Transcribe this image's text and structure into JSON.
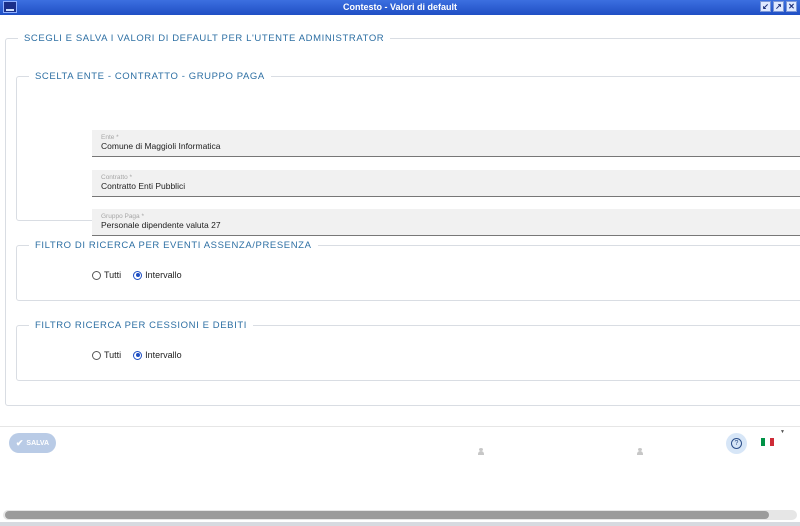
{
  "window": {
    "title": "Contesto - Valori di default",
    "controls": [
      "minimize-icon",
      "maximize-icon",
      "close-icon"
    ]
  },
  "outer_section": {
    "legend": "SCEGLI E SALVA I VALORI DI DEFAULT PER L'UTENTE ADMINISTRATOR"
  },
  "group_ente": {
    "legend": "SCELTA ENTE - CONTRATTO - GRUPPO PAGA",
    "fields": [
      {
        "label": "Ente *",
        "value": "Comune di Maggioli Informatica"
      },
      {
        "label": "Contratto *",
        "value": "Contratto Enti Pubblici"
      },
      {
        "label": "Gruppo Paga *",
        "value": "Personale dipendente valuta 27"
      }
    ]
  },
  "group_eventi": {
    "legend": "FILTRO DI RICERCA PER EVENTI ASSENZA/PRESENZA",
    "options": [
      {
        "label": "Tutti",
        "checked": false
      },
      {
        "label": "Intervallo",
        "checked": true
      }
    ]
  },
  "group_cessioni": {
    "legend": "FILTRO RICERCA PER CESSIONI E DEBITI",
    "options": [
      {
        "label": "Tutti",
        "checked": false
      },
      {
        "label": "Intervallo",
        "checked": true
      }
    ]
  },
  "footer": {
    "save_label": "SALVA",
    "help_icon": "help-icon",
    "language_flag": "italian-flag-icon",
    "flag_colors": [
      "#009246",
      "#ffffff",
      "#ce2b37"
    ]
  },
  "colors": {
    "titlebar": "#1f4fc4",
    "accent": "#2d6fa3",
    "radio_checked": "#1f4fc4"
  }
}
